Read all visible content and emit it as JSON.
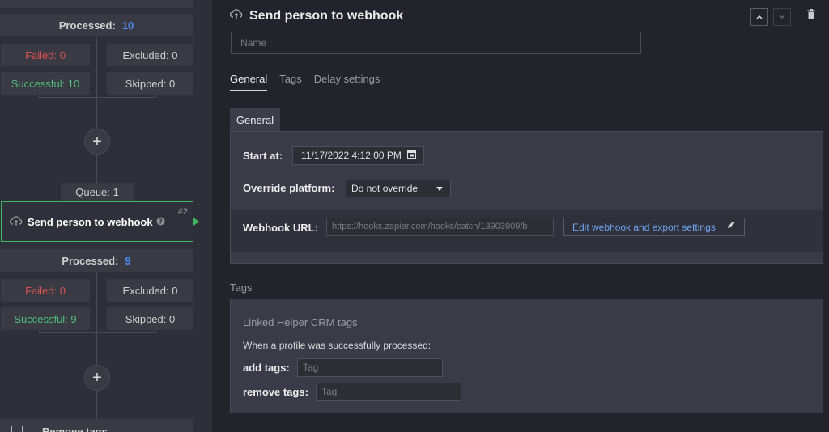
{
  "flow": {
    "upper": {
      "processed_label": "Processed:",
      "processed_count": "10",
      "failed": "Failed:  0",
      "excluded": "Excluded:  0",
      "successful": "Successful:  10",
      "skipped": "Skipped:  0"
    },
    "queue": "Queue:  1",
    "node": {
      "title": "Send person to webhook",
      "number": "#2"
    },
    "lower": {
      "processed_label": "Processed:",
      "processed_count": "9",
      "failed": "Failed:  0",
      "excluded": "Excluded:  0",
      "successful": "Successful:  9",
      "skipped": "Skipped:  0"
    },
    "plus": "+",
    "bottom_node_title": "Remove tags"
  },
  "detail": {
    "title": "Send person to webhook",
    "name_placeholder": "Name",
    "tabs": [
      "General",
      "Tags",
      "Delay settings"
    ],
    "general_subtab": "General",
    "start_at_label": "Start at:",
    "start_at_value": "11/17/2022 4:12:00 PM",
    "override_label": "Override platform:",
    "override_value": "Do not override",
    "webhook_label": "Webhook URL:",
    "webhook_value": "https://hooks.zapier.com/hooks/catch/13903909/b",
    "webhook_button": "Edit webhook and export settings",
    "tags_section_title": "Tags",
    "crm_title": "Linked Helper CRM tags",
    "when_text": "When a profile was successfully processed:",
    "add_tags_label": "add tags:",
    "add_tags_placeholder": "Tag",
    "remove_tags_label": "remove tags:",
    "remove_tags_placeholder": "Tag"
  },
  "colors": {
    "accent_green": "#3fb860",
    "link_blue": "#6ea4f2",
    "failed_red": "#d9534f",
    "success_green": "#4fbf7a"
  },
  "icons": [
    "cloud-upload-icon",
    "help-icon",
    "chevron-up-icon",
    "chevron-down-icon",
    "trash-icon",
    "calendar-icon",
    "caret-down-icon",
    "pencil-icon",
    "plus-icon"
  ]
}
